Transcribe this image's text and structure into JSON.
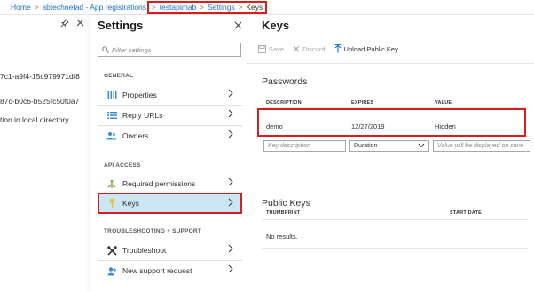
{
  "breadcrumb": {
    "home": "Home",
    "app_registrations": "abtechnetad - App registrations",
    "app": "testapimab",
    "settings": "Settings",
    "keys": "Keys",
    "separator": ">"
  },
  "left_pane": {
    "app_id_fragment": "7c1-a9f4-15c979971df8",
    "object_id_fragment": "87c-b0c6-b525fc50f0a7",
    "local_dir_fragment": "tion in local directory"
  },
  "settings": {
    "title": "Settings",
    "filter_placeholder": "Filter settings",
    "general_header": "GENERAL",
    "api_access_header": "API ACCESS",
    "support_header": "TROUBLESHOOTING + SUPPORT",
    "items": [
      {
        "label": "Properties",
        "icon": "properties-icon"
      },
      {
        "label": "Reply URLs",
        "icon": "list-icon"
      },
      {
        "label": "Owners",
        "icon": "users-icon"
      },
      {
        "label": "Required permissions",
        "icon": "permissions-icon"
      },
      {
        "label": "Keys",
        "icon": "key-icon",
        "selected": true
      },
      {
        "label": "Troubleshoot",
        "icon": "tools-icon"
      },
      {
        "label": "New support request",
        "icon": "support-icon"
      }
    ]
  },
  "keys": {
    "title": "Keys",
    "toolbar": {
      "save": "Save",
      "discard": "Discard",
      "upload": "Upload Public Key"
    },
    "passwords_title": "Passwords",
    "password_columns": [
      "DESCRIPTION",
      "EXPIRES",
      "VALUE"
    ],
    "password_rows": [
      {
        "description": "demo",
        "expires": "12/27/2019",
        "value": "Hidden"
      }
    ],
    "new_key": {
      "description_placeholder": "Key description",
      "duration_value": "Duration",
      "value_placeholder": "Value will be displayed on save"
    },
    "public_keys_title": "Public Keys",
    "public_columns": [
      "THUMBPRINT",
      "START DATE"
    ],
    "public_empty": "No results."
  },
  "colors": {
    "accent": "#1f6fbf",
    "highlight_border": "#d91c1c",
    "selected_bg": "#cde6f7"
  }
}
